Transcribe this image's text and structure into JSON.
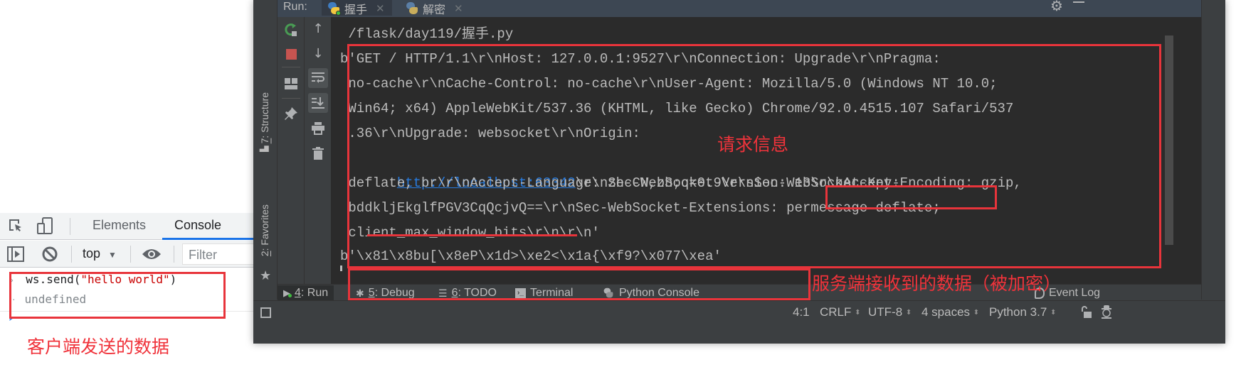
{
  "devtools": {
    "tabs": [
      {
        "label": "Elements",
        "active": false
      },
      {
        "label": "Console",
        "active": true
      }
    ],
    "context_select": "top",
    "filter_placeholder": "Filter",
    "console": {
      "command_prefix": "ws.send(",
      "command_string": "\"hello world\"",
      "command_suffix": ")",
      "result": "undefined"
    }
  },
  "ide": {
    "run_label": "Run:",
    "run_tabs": [
      {
        "label": "握手",
        "active": true
      },
      {
        "label": "解密",
        "active": false
      }
    ],
    "left_vertical_tabs": [
      {
        "num": "7",
        "label": ": Structure"
      },
      {
        "num": "2",
        "label": ": Favorites"
      }
    ],
    "console_lines": [
      " /flask/day119/握手.py",
      "b'GET / HTTP/1.1\\r\\nHost: 127.0.0.1:9527\\r\\nConnection: Upgrade\\r\\nPragma:",
      " no-cache\\r\\nCache-Control: no-cache\\r\\nUser-Agent: Mozilla/5.0 (Windows NT 10.0;",
      " Win64; x64) AppleWebKit/537.36 (KHTML, like Gecko) Chrome/92.0.4515.107 Safari/537",
      " .36\\r\\nUpgrade: websocket\\r\\nOrigin: ",
      "\\r\\nSec-WebSocket-Version: 13\\r\\nAccept-Encoding: gzip,",
      " deflate, br\\r\\nAccept-Language: zh-CN,zh;q=0.9\\r\\nSec-WebSocket-Key:",
      " bddkljEkglfPGV3CqQcjvQ==\\r\\nSec-WebSocket-Extensions: permessage-deflate;",
      " client_max_window_bits\\r\\n\\r\\n'",
      "b'\\x81\\x8bu[\\x8eP\\x1d>\\xe2<\\x1a{\\xf9?\\x077\\xea'"
    ],
    "origin_link": "http://localhost:63342",
    "bottom_tabs": [
      {
        "num": "4",
        "label": ": Run",
        "active": true
      },
      {
        "num": "5",
        "label": ": Debug",
        "active": false
      },
      {
        "num": "6",
        "label": ": TODO",
        "active": false
      },
      {
        "num": "",
        "label": "Terminal",
        "active": false
      },
      {
        "num": "",
        "label": "Python Console",
        "active": false
      }
    ],
    "event_log": "Event Log",
    "status": {
      "position": "4:1",
      "line_sep": "CRLF",
      "encoding": "UTF-8",
      "indent": "4 spaces",
      "interpreter": "Python 3.7"
    }
  },
  "annotations": {
    "request_info": "请求信息",
    "server_received": "服务端接收到的数据（被加密）",
    "client_sent": "客户端发送的数据"
  },
  "colors": {
    "annotation_red": "#e8343b",
    "ide_bg": "#2b2b2b",
    "link_blue": "#287bde",
    "devtools_accent": "#1a73e8"
  }
}
